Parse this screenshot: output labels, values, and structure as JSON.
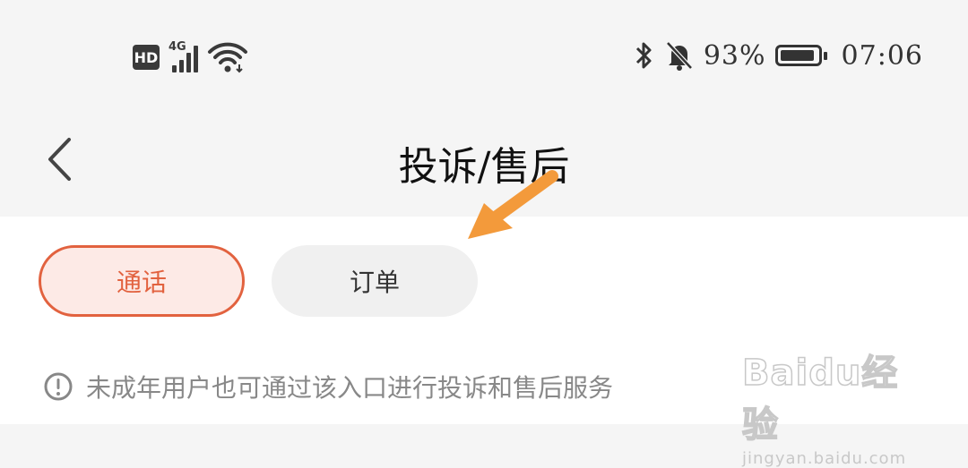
{
  "status_bar": {
    "hd_label": "HD",
    "network_label": "4G",
    "battery_percent": "93%",
    "battery_level": 0.93,
    "time": "07:06"
  },
  "nav": {
    "title": "投诉/售后"
  },
  "tabs": [
    {
      "label": "通话",
      "active": true
    },
    {
      "label": "订单",
      "active": false
    }
  ],
  "notice": {
    "text": "未成年用户也可通过该入口进行投诉和售后服务"
  },
  "watermark": {
    "logo_text": "Baidu经验",
    "url": "jingyan.baidu.com"
  },
  "colors": {
    "accent": "#e2623f",
    "accent_bg": "#fdeae6",
    "arrow": "#f39a3b",
    "page_bg": "#f5f5f5"
  }
}
